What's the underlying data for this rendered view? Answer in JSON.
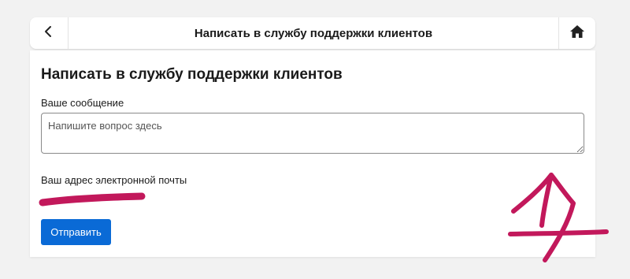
{
  "header": {
    "title": "Написать в службу поддержки клиентов",
    "back_icon": "chevron-left-icon",
    "home_icon": "home-icon"
  },
  "form": {
    "heading": "Написать в службу поддержки клиентов",
    "message_label": "Ваше сообщение",
    "message_placeholder": "Напишите вопрос здесь",
    "message_value": "",
    "email_label": "Ваш адрес электронной почты",
    "submit_label": "Отправить"
  },
  "colors": {
    "page_background": "#f2f2f2",
    "button_blue": "#0a6ad6",
    "redaction_ink": "#c2185b"
  }
}
